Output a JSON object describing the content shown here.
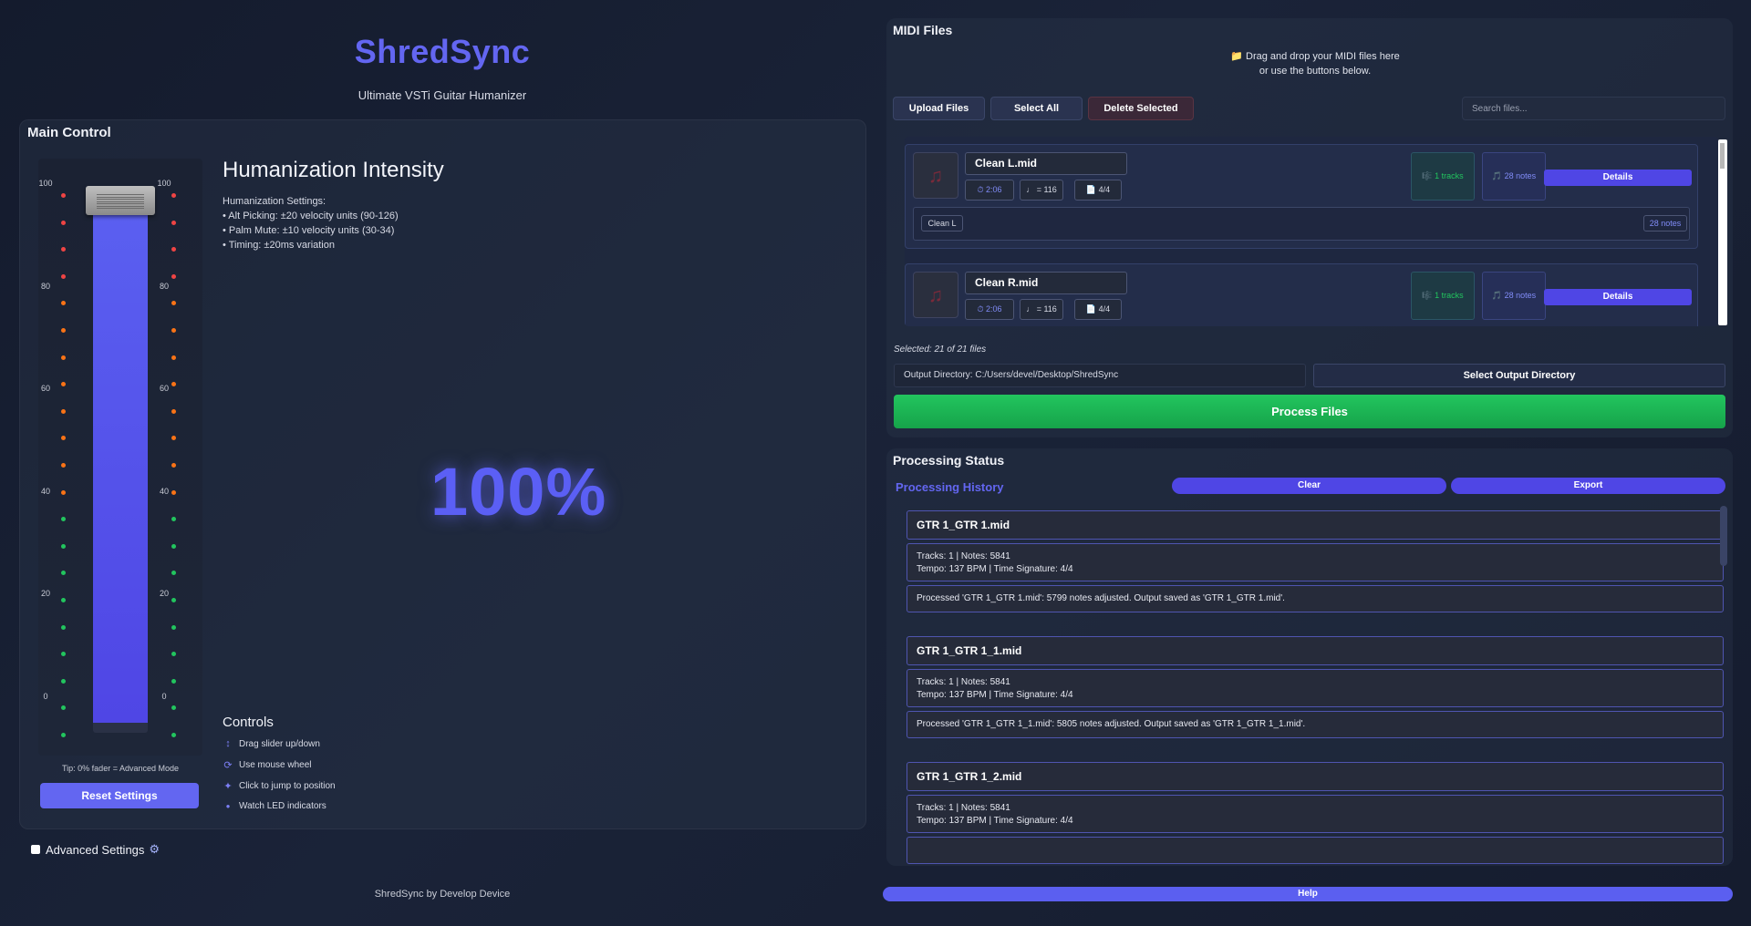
{
  "app": {
    "title": "ShredSync",
    "subtitle": "Ultimate VSTi Guitar Humanizer",
    "credit": "ShredSync by Develop Device"
  },
  "main_control": {
    "title": "Main Control",
    "fader_value": 100,
    "scale_labels": [
      "100",
      "80",
      "60",
      "40",
      "20",
      "0"
    ],
    "tip": "Tip: 0% fader = Advanced Mode",
    "reset_label": "Reset Settings"
  },
  "humanization": {
    "title": "Humanization Intensity",
    "settings_heading": "Humanization Settings:",
    "settings": [
      "• Alt Picking: ±20 velocity units (90-126)",
      "• Palm Mute: ±10 velocity units (30-34)",
      "• Timing: ±20ms variation"
    ],
    "percent_display": "100%"
  },
  "controls": {
    "title": "Controls",
    "items": [
      {
        "icon": "updown-arrow-icon",
        "label": "Drag slider up/down"
      },
      {
        "icon": "refresh-icon",
        "label": "Use mouse wheel"
      },
      {
        "icon": "sparkle-icon",
        "label": "Click to jump to position"
      },
      {
        "icon": "dot-icon",
        "label": "Watch LED indicators"
      }
    ]
  },
  "advanced": {
    "label": "Advanced Settings",
    "checked": false,
    "icon": "gear-icon"
  },
  "midi_files": {
    "title": "MIDI Files",
    "drop_line1": "📁 Drag and drop your MIDI files here",
    "drop_line2": "or use the buttons below.",
    "upload_label": "Upload Files",
    "select_all_label": "Select All",
    "delete_label": "Delete Selected",
    "search_placeholder": "Search files...",
    "files": [
      {
        "name": "Clean L.mid",
        "duration": "⏱ 2:06",
        "tempo": "♩ = 116",
        "time_sig": "📄 4/4",
        "tracks": "🎼 1 tracks",
        "notes": "🎵 28 notes",
        "details": "Details",
        "track_name": "Clean L",
        "track_notes": "28 notes"
      },
      {
        "name": "Clean R.mid",
        "duration": "⏱ 2:06",
        "tempo": "♩ = 116",
        "time_sig": "📄 4/4",
        "tracks": "🎼 1 tracks",
        "notes": "🎵 28 notes",
        "details": "Details"
      }
    ],
    "selected_text": "Selected: 21 of 21 files",
    "output_dir": "Output Directory: C:/Users/devel/Desktop/ShredSync",
    "output_btn": "Select Output Directory",
    "process_btn": "Process Files"
  },
  "processing": {
    "title": "Processing Status",
    "history_title": "Processing History",
    "clear_label": "Clear",
    "export_label": "Export",
    "entries": [
      {
        "name": "GTR 1_GTR 1.mid",
        "info1": "Tracks: 1 | Notes: 5841",
        "info2": "Tempo: 137 BPM | Time Signature: 4/4",
        "msg": "Processed 'GTR 1_GTR 1.mid': 5799 notes adjusted. Output saved as 'GTR 1_GTR 1.mid'."
      },
      {
        "name": "GTR 1_GTR 1_1.mid",
        "info1": "Tracks: 1 | Notes: 5841",
        "info2": "Tempo: 137 BPM | Time Signature: 4/4",
        "msg": "Processed 'GTR 1_GTR 1_1.mid': 5805 notes adjusted. Output saved as 'GTR 1_GTR 1_1.mid'."
      },
      {
        "name": "GTR 1_GTR 1_2.mid",
        "info1": "Tracks: 1 | Notes: 5841",
        "info2": "Tempo: 137 BPM | Time Signature: 4/4"
      }
    ]
  },
  "help_label": "Help",
  "colors": {
    "accent": "#6366f1",
    "process_green": "#22c55e",
    "led_red": "#ef4444",
    "led_orange": "#f97316",
    "led_green": "#22c55e"
  }
}
